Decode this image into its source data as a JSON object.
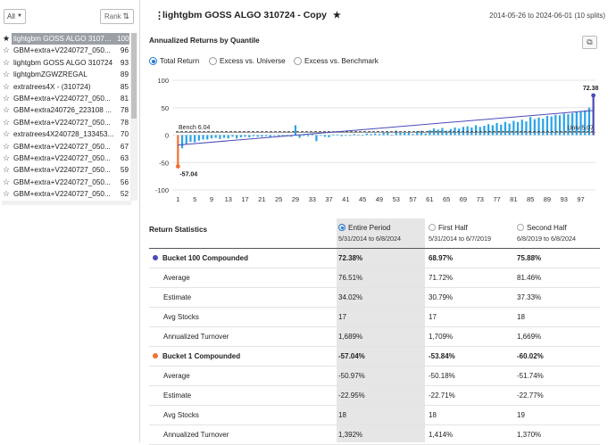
{
  "sidebar": {
    "filter_label": "All",
    "rank_label": "Rank",
    "items": [
      {
        "name": "lightgbm GOSS ALGO 310724 - Copy",
        "rank": "100",
        "selected": true
      },
      {
        "name": "GBM+extra+V2240727_050...",
        "rank": "96"
      },
      {
        "name": "lightgbm GOSS ALGO 310724",
        "rank": "93"
      },
      {
        "name": "lightgbmZGWZREGAL",
        "rank": "89"
      },
      {
        "name": "extratrees4X - (310724)",
        "rank": "85"
      },
      {
        "name": "GBM+extra+V2240727_050...",
        "rank": "81"
      },
      {
        "name": "GBM+extra240726_223108 ...",
        "rank": "78"
      },
      {
        "name": "GBM+extra+V2240727_050...",
        "rank": "78"
      },
      {
        "name": "extratrees4X240728_133453...",
        "rank": "70"
      },
      {
        "name": "GBM+extra+V2240727_050...",
        "rank": "67"
      },
      {
        "name": "GBM+extra+V2240727_050...",
        "rank": "63"
      },
      {
        "name": "GBM+extra+V2240727_050...",
        "rank": "59"
      },
      {
        "name": "GBM+extra+V2240727_050...",
        "rank": "56"
      },
      {
        "name": "GBM+extra+V2240727_050...",
        "rank": "52"
      }
    ]
  },
  "header": {
    "title": "lightgbm GOSS ALGO 310724 - Copy",
    "date_range": "2014-05-26 to 2024-06-01 (10 splits)"
  },
  "section_title": "Annualized Returns by Quantile",
  "radios": [
    {
      "label": "Total Return",
      "selected": true
    },
    {
      "label": "Excess vs. Universe",
      "selected": false
    },
    {
      "label": "Excess vs. Benchmark",
      "selected": false
    }
  ],
  "chart_data": {
    "type": "bar",
    "x_ticks": [
      "1",
      "5",
      "9",
      "13",
      "17",
      "21",
      "25",
      "29",
      "33",
      "37",
      "41",
      "45",
      "49",
      "53",
      "57",
      "61",
      "65",
      "69",
      "73",
      "77",
      "81",
      "85",
      "89",
      "93",
      "97"
    ],
    "y_ticks": [
      "100",
      "50",
      "0",
      "-50",
      "-100"
    ],
    "ylim": [
      -100,
      100
    ],
    "xlim": [
      1,
      100
    ],
    "values": [
      -57.04,
      -24,
      -16,
      -12,
      -13,
      -10,
      -8,
      -8,
      -6,
      -5,
      -7,
      -5,
      -6,
      -3,
      -6,
      -4,
      -3,
      -4,
      -2,
      -3,
      -3,
      -2,
      -4,
      -1,
      -3,
      -2,
      -1,
      -3,
      18,
      -5,
      -1,
      -2,
      2,
      -11,
      -1,
      -3,
      -4,
      1,
      1,
      -2,
      0,
      -1,
      2,
      1,
      -1,
      3,
      2,
      3,
      2,
      4,
      5,
      -1,
      8,
      4,
      4,
      6,
      2,
      7,
      8,
      3,
      9,
      12,
      10,
      13,
      8,
      11,
      14,
      12,
      15,
      16,
      14,
      18,
      15,
      17,
      20,
      18,
      22,
      19,
      24,
      21,
      26,
      24,
      28,
      25,
      33,
      29,
      32,
      30,
      35,
      34,
      37,
      36,
      39,
      38,
      40,
      42,
      44,
      45,
      50,
      72.38
    ],
    "bar_color": "#29a3e8",
    "first_bar_color": "#f07034",
    "last_bar_color": "#4a4ab8",
    "annotations": {
      "benchmark_label": "Bench 6.04",
      "benchmark_value": 6.04,
      "universe_label": "Univ 5.07",
      "universe_value": 5.07,
      "top_label": "72.38",
      "bottom_label": "-57.04"
    }
  },
  "table": {
    "title": "Return Statistics",
    "columns": [
      {
        "label": "Entire Period",
        "sub": "5/31/2014 to 6/8/2024",
        "selected": true
      },
      {
        "label": "First Half",
        "sub": "5/31/2014 to 6/7/2019",
        "selected": false
      },
      {
        "label": "Second Half",
        "sub": "6/8/2019 to 6/8/2024",
        "selected": false
      }
    ],
    "rows": [
      {
        "label": "Bucket 100 Compounded",
        "bold": true,
        "dot": "#4a4ab8",
        "values": [
          "72.38%",
          "68.97%",
          "75.88%"
        ]
      },
      {
        "label": "Average",
        "values": [
          "76.51%",
          "71.72%",
          "81.46%"
        ]
      },
      {
        "label": "Estimate",
        "values": [
          "34.02%",
          "30.79%",
          "37.33%"
        ]
      },
      {
        "label": "Avg Stocks",
        "values": [
          "17",
          "17",
          "18"
        ]
      },
      {
        "label": "Annualized Turnover",
        "values": [
          "1,689%",
          "1,709%",
          "1,669%"
        ]
      },
      {
        "label": "Bucket 1 Compounded",
        "bold": true,
        "dot": "#f07034",
        "values": [
          "-57.04%",
          "-53.84%",
          "-60.02%"
        ]
      },
      {
        "label": "Average",
        "values": [
          "-50.97%",
          "-50.18%",
          "-51.74%"
        ]
      },
      {
        "label": "Estimate",
        "values": [
          "-22.95%",
          "-22.71%",
          "-22.77%"
        ]
      },
      {
        "label": "Avg Stocks",
        "values": [
          "18",
          "18",
          "19"
        ]
      },
      {
        "label": "Annualized Turnover",
        "values": [
          "1,392%",
          "1,414%",
          "1,370%"
        ]
      }
    ]
  }
}
